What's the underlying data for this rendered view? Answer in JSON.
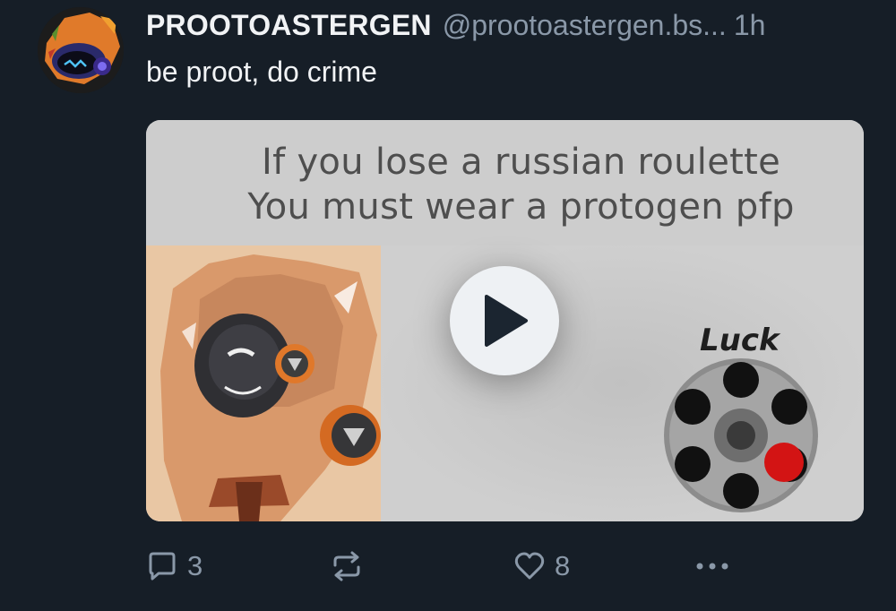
{
  "post": {
    "author": {
      "display_name": "PROOTOASTERGEN",
      "handle": "@prootoastergen.bs...",
      "avatar_icon": "protogen-avatar-icon"
    },
    "time": "1h",
    "text": "be proot, do crime",
    "media": {
      "caption_line_1": "If you lose a russian roulette",
      "caption_line_2": "You must wear a protogen pfp",
      "luck_label": "Luck",
      "play_icon": "play-icon"
    },
    "actions": {
      "reply_count": "3",
      "like_count": "8",
      "reply_icon": "comment-bubble-icon",
      "repost_icon": "repost-icon",
      "like_icon": "heart-icon",
      "more_icon": "ellipsis-icon"
    }
  },
  "colors": {
    "background": "#161e27",
    "primary_text": "#f1f3f5",
    "secondary_text": "#8a98a8",
    "media_background": "#c9c9c9",
    "revolver_red": "#d31414"
  }
}
